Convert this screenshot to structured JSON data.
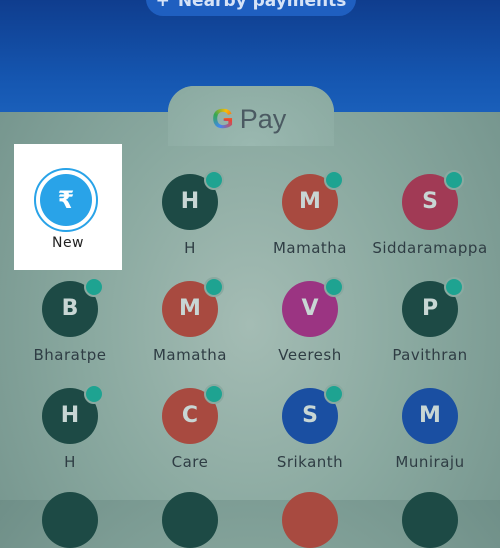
{
  "header": {
    "nearby_label": "Nearby payments"
  },
  "brand": {
    "g": "G",
    "pay": "Pay"
  },
  "new_payment": {
    "icon": "₹",
    "label": "New",
    "accent": "#29a3e8"
  },
  "contacts": [
    {
      "initial": "H",
      "name": "H",
      "color": "#1d4a45",
      "online": true
    },
    {
      "initial": "M",
      "name": "Mamatha",
      "color": "#a84a40",
      "online": true
    },
    {
      "initial": "S",
      "name": "Siddaramappa",
      "color": "#a13a55",
      "online": true
    },
    {
      "initial": "B",
      "name": "Bharatpe",
      "color": "#1d4a45",
      "online": true
    },
    {
      "initial": "M",
      "name": "Mamatha",
      "color": "#a84a40",
      "online": true
    },
    {
      "initial": "V",
      "name": "Veeresh",
      "color": "#9b3482",
      "online": true
    },
    {
      "initial": "P",
      "name": "Pavithran",
      "color": "#1d4a45",
      "online": true
    },
    {
      "initial": "H",
      "name": "H",
      "color": "#1d4a45",
      "online": true
    },
    {
      "initial": "C",
      "name": "Care",
      "color": "#a84a40",
      "online": true
    },
    {
      "initial": "S",
      "name": "Srikanth",
      "color": "#1a4fa2",
      "online": true
    },
    {
      "initial": "M",
      "name": "Muniraju",
      "color": "#1a4fa2",
      "online": false
    }
  ],
  "colors": {
    "online_dot": "#1ea391",
    "header_blue": "#1556b0"
  }
}
